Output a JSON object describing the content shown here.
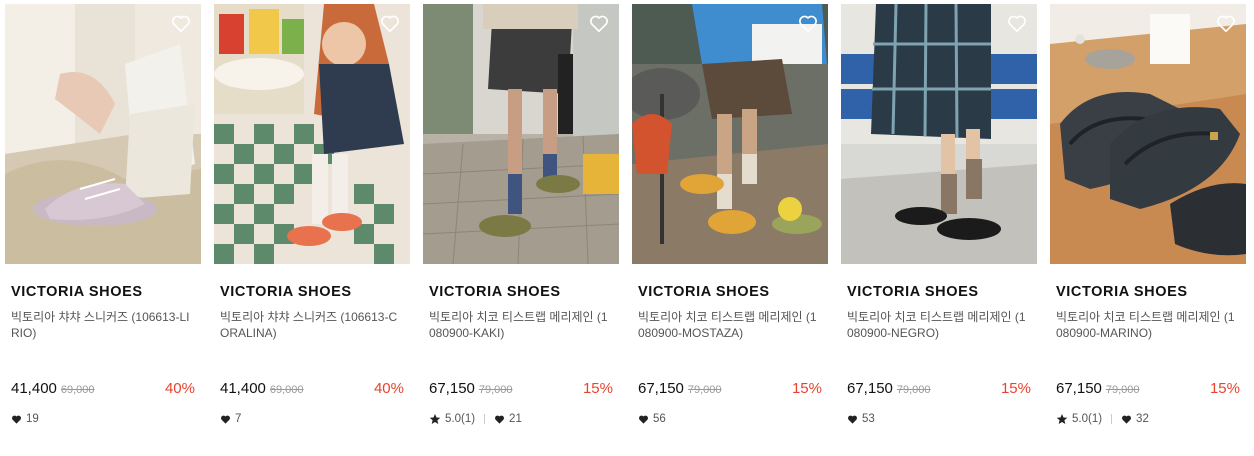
{
  "products": [
    {
      "brand": "VICTORIA SHOES",
      "name": "빅토리아 챠챠 스니커즈 (106613-LIRIO)",
      "price": "41,400",
      "original_price": "69,000",
      "discount": "40%",
      "rating": "",
      "likes": "19"
    },
    {
      "brand": "VICTORIA SHOES",
      "name": "빅토리아 챠챠 스니커즈 (106613-CORALINA)",
      "price": "41,400",
      "original_price": "69,000",
      "discount": "40%",
      "rating": "",
      "likes": "7"
    },
    {
      "brand": "VICTORIA SHOES",
      "name": "빅토리아 치코 티스트랩 메리제인 (1080900-KAKI)",
      "price": "67,150",
      "original_price": "79,000",
      "discount": "15%",
      "rating": "5.0(1)",
      "likes": "21"
    },
    {
      "brand": "VICTORIA SHOES",
      "name": "빅토리아 치코 티스트랩 메리제인 (1080900-MOSTAZA)",
      "price": "67,150",
      "original_price": "79,000",
      "discount": "15%",
      "rating": "",
      "likes": "56"
    },
    {
      "brand": "VICTORIA SHOES",
      "name": "빅토리아 치코 티스트랩 메리제인 (1080900-NEGRO)",
      "price": "67,150",
      "original_price": "79,000",
      "discount": "15%",
      "rating": "",
      "likes": "53"
    },
    {
      "brand": "VICTORIA SHOES",
      "name": "빅토리아 치코 티스트랩 메리제인 (1080900-MARINO)",
      "price": "67,150",
      "original_price": "79,000",
      "discount": "15%",
      "rating": "5.0(1)",
      "likes": "32"
    }
  ],
  "colors": {
    "discount": "#e8432e",
    "text": "#111111",
    "muted": "#999999"
  },
  "icons": {
    "wishlist": "heart-outline-icon",
    "likes": "heart-icon",
    "rating": "star-icon"
  }
}
